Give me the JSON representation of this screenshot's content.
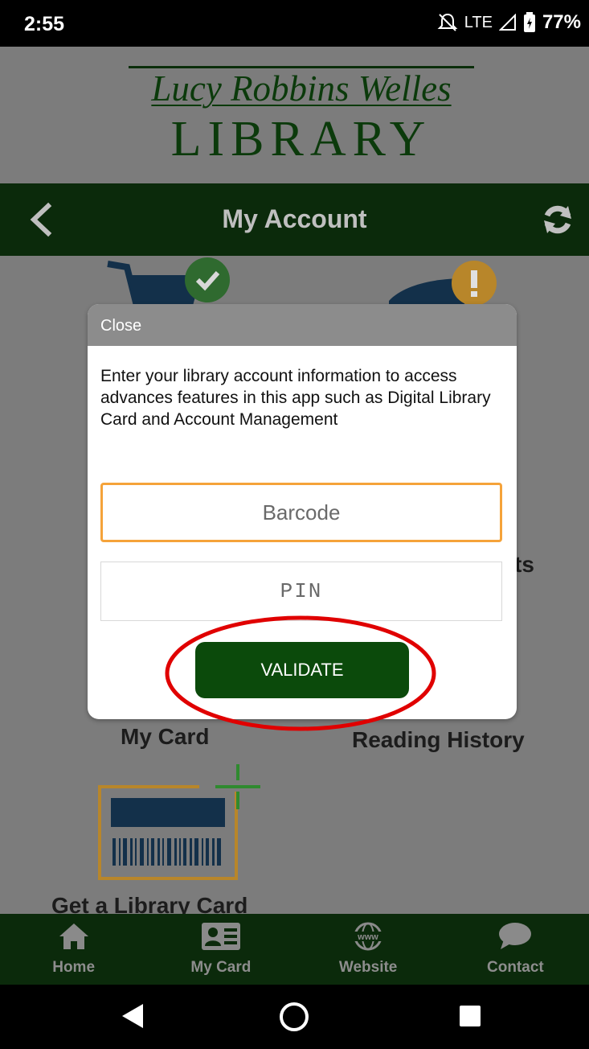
{
  "status_bar": {
    "time": "2:55",
    "network": "LTE",
    "battery": "77%"
  },
  "logo": {
    "script_name": "Lucy Robbins Welles",
    "library_word": "LIBRARY"
  },
  "nav": {
    "title": "My Account",
    "back_icon": "chevron-left-icon",
    "refresh_icon": "refresh-icon"
  },
  "background_tiles": {
    "partial_label": "ts",
    "my_card_label": "My Card",
    "reading_history_label": "Reading History",
    "get_card_label": "Get a Library Card"
  },
  "modal": {
    "close_label": "Close",
    "message": "Enter your library account information to access advances features in this app such as Digital Library Card and Account Management",
    "barcode_placeholder": "Barcode",
    "pin_placeholder": "PIN",
    "validate_label": "VALIDATE"
  },
  "tabs": [
    {
      "label": "Home",
      "icon": "home-icon"
    },
    {
      "label": "My Card",
      "icon": "id-card-icon"
    },
    {
      "label": "Website",
      "icon": "globe-www-icon"
    },
    {
      "label": "Contact",
      "icon": "speech-bubble-icon"
    }
  ],
  "colors": {
    "brand_green": "#0b2a0b",
    "button_green": "#0b4a0b",
    "focus_orange": "#f5a33a",
    "annotation_red": "#e00000"
  }
}
